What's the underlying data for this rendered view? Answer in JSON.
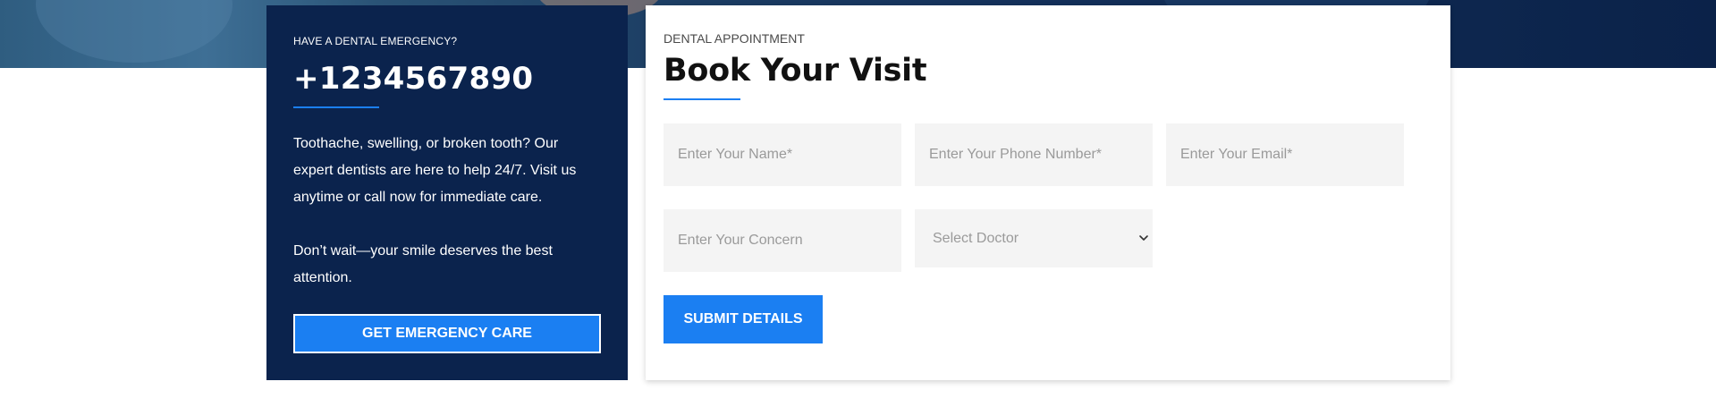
{
  "colors": {
    "navy": "#0b234d",
    "accent": "#1b7ff2",
    "field_bg": "#f4f4f4"
  },
  "emergency": {
    "kicker": "HAVE A DENTAL EMERGENCY?",
    "phone": "+1234567890",
    "paragraph1": "Toothache, swelling, or broken tooth? Our expert dentists are here to help 24/7. Visit us anytime or call now for immediate care.",
    "paragraph2": "Don’t wait—your smile deserves the best attention.",
    "button_label": "GET EMERGENCY CARE"
  },
  "appointment": {
    "kicker": "DENTAL APPOINTMENT",
    "title": "Book Your Visit",
    "fields": {
      "name_placeholder": "Enter Your Name*",
      "phone_placeholder": "Enter Your Phone Number*",
      "email_placeholder": "Enter Your Email*",
      "concern_placeholder": "Enter Your Concern",
      "doctor_selected": "Select Doctor"
    },
    "submit_label": "SUBMIT DETAILS",
    "select_icon": "chevron-down-icon"
  }
}
